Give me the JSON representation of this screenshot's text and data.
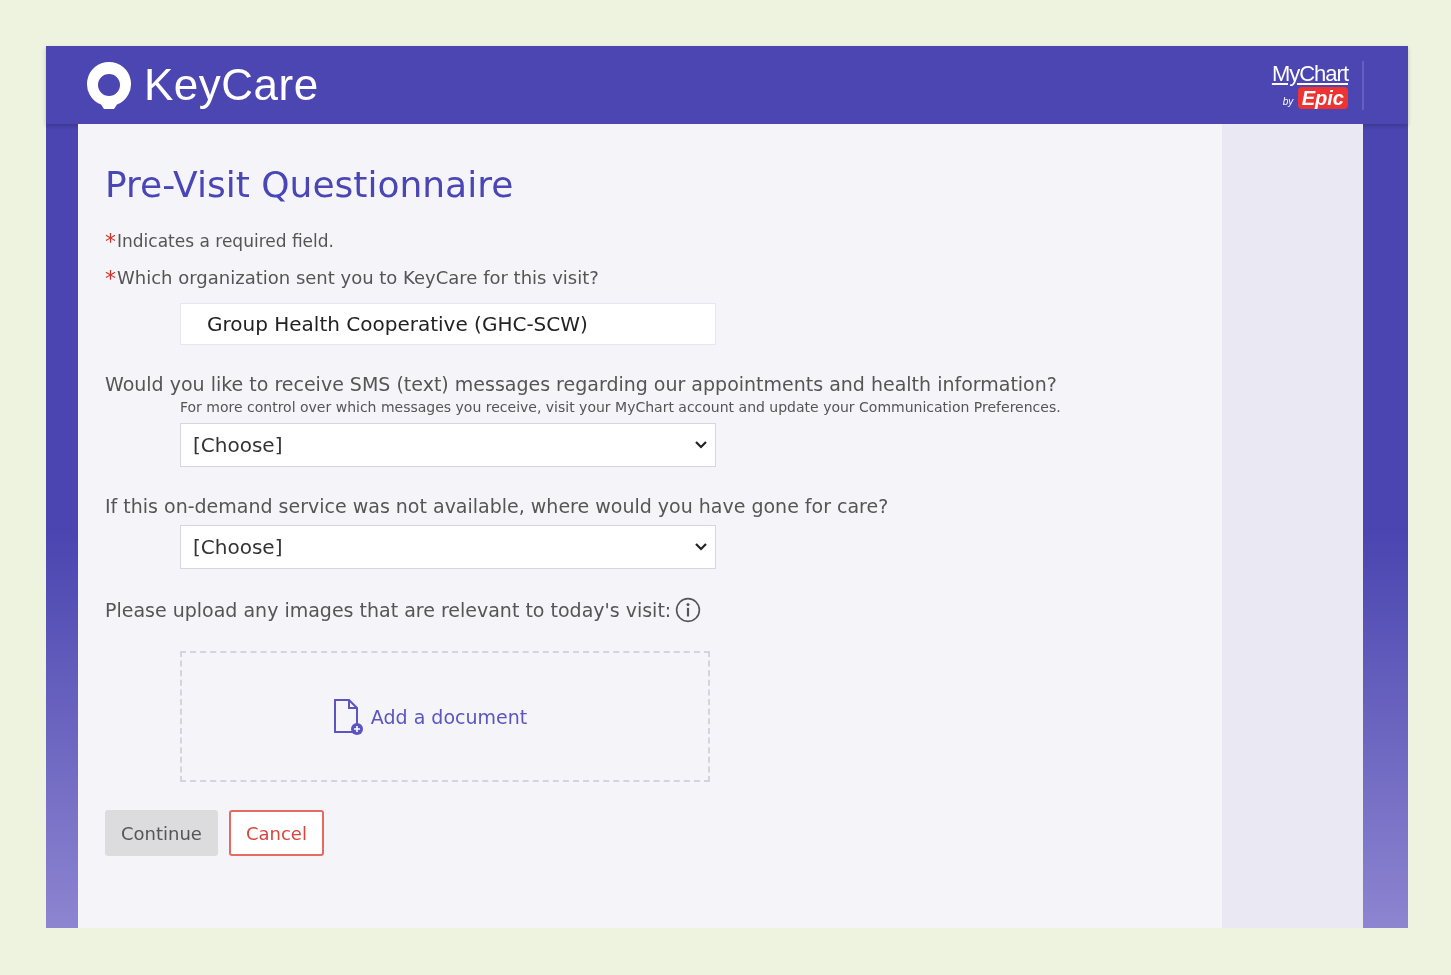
{
  "header": {
    "brand": "KeyCare",
    "partner_top": "MyChart",
    "partner_by": "by",
    "partner_name": "Epic"
  },
  "page_title": "Pre-Visit Questionnaire",
  "required_note": {
    "mark": "*",
    "text": "Indicates a required field."
  },
  "questions": [
    {
      "kind": "text",
      "required": true,
      "label": "Which organization sent you to KeyCare for this visit?",
      "value": "Group Health Cooperative (GHC-SCW)"
    },
    {
      "kind": "select",
      "required": false,
      "label": "Would you like to receive SMS (text) messages regarding our appointments and health information?",
      "hint": "For more control over which messages you receive, visit your MyChart account and update your Communication Preferences.",
      "value": "[Choose]"
    },
    {
      "kind": "select",
      "required": false,
      "label": "If this on-demand service was not available, where would you have gone for care?",
      "value": "[Choose]"
    },
    {
      "kind": "upload",
      "required": false,
      "label": "Please upload any images that are relevant to today's visit:",
      "info": true,
      "action": "Add a document"
    }
  ],
  "buttons": [
    {
      "kind": "primary",
      "label": "Continue",
      "disabled": true
    },
    {
      "kind": "cancel",
      "label": "Cancel",
      "disabled": false
    }
  ]
}
